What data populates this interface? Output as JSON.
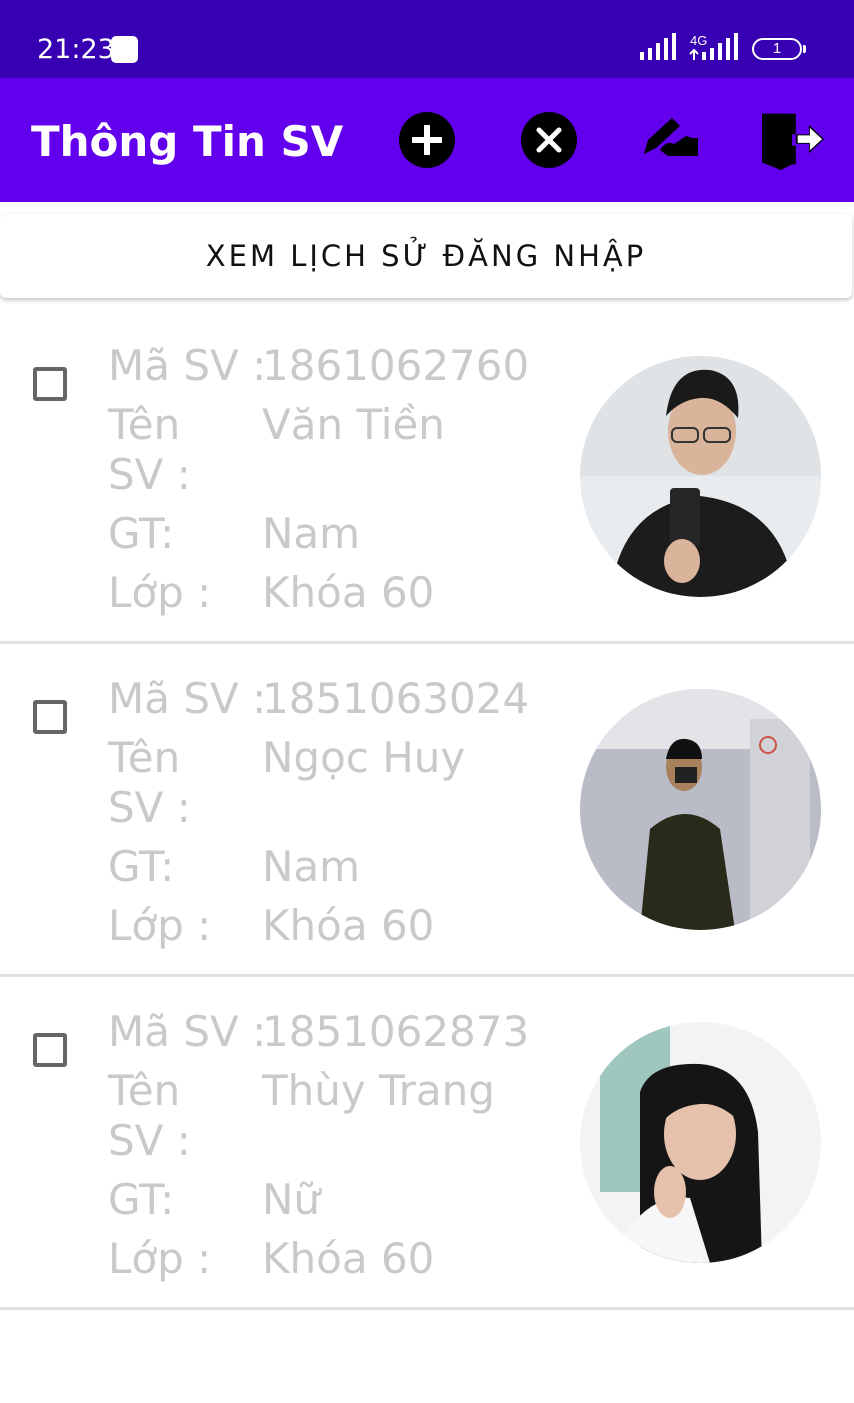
{
  "status_bar": {
    "time": "21:23",
    "network_type": "4G",
    "battery_level": "1",
    "icons": [
      "notification-icon",
      "signal-icon",
      "signal-4g-icon",
      "battery-icon"
    ]
  },
  "app_bar": {
    "title": "Thông Tin SV",
    "actions": [
      "add-icon",
      "delete-icon",
      "edit-icon",
      "logout-icon"
    ]
  },
  "history_button": {
    "label": "XEM LỊCH SỬ ĐĂNG NHẬP"
  },
  "field_labels": {
    "id": "Mã SV :",
    "name": "Tên SV :",
    "gender": "GT:",
    "class": "Lớp :"
  },
  "students": [
    {
      "id": "1861062760",
      "name": "Văn Tiền",
      "gender": "Nam",
      "class": "Khóa 60",
      "checked": false,
      "avatar": "avatar-photo"
    },
    {
      "id": "1851063024",
      "name": "Ngọc Huy",
      "gender": "Nam",
      "class": "Khóa 60",
      "checked": false,
      "avatar": "avatar-photo"
    },
    {
      "id": "1851062873",
      "name": "Thùy Trang",
      "gender": "Nữ",
      "class": "Khóa 60",
      "checked": false,
      "avatar": "avatar-photo"
    }
  ],
  "colors": {
    "status_bar": "#3700b3",
    "app_bar": "#6200ee",
    "text_faded": "#c9c9c9"
  }
}
